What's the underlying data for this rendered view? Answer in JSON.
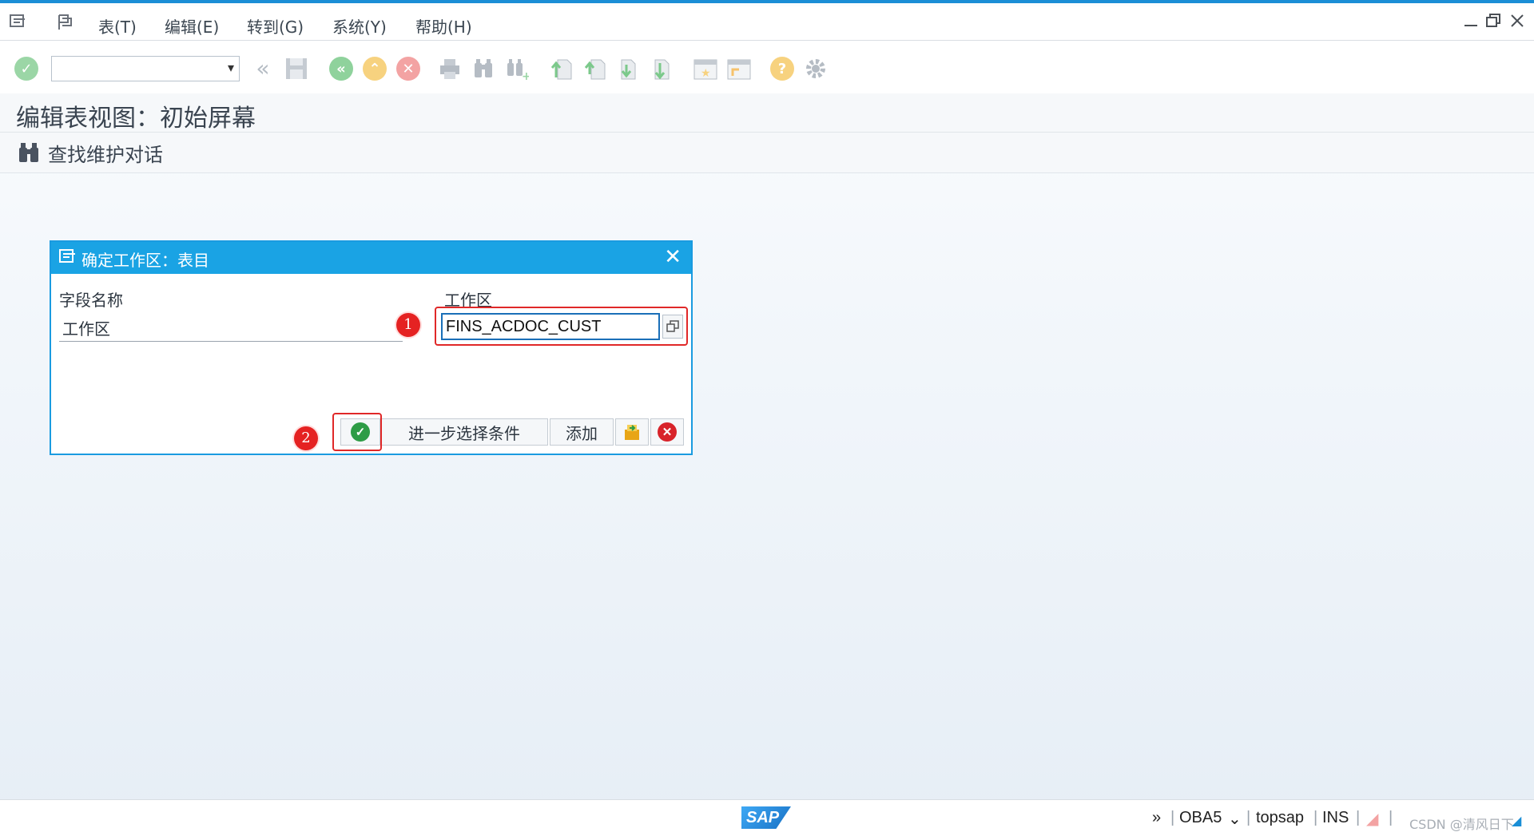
{
  "menu": {
    "items": [
      {
        "label": "表(T)"
      },
      {
        "label": "编辑(E)"
      },
      {
        "label": "转到(G)"
      },
      {
        "label": "系统(Y)"
      },
      {
        "label": "帮助(H)"
      }
    ]
  },
  "toolbar": {
    "command_field_value": "",
    "icons": [
      "enter-icon",
      "back-icon",
      "save-icon",
      "back-green-icon",
      "exit-icon",
      "cancel-icon",
      "print-icon",
      "find-icon",
      "find-next-icon",
      "first-page-icon",
      "previous-page-icon",
      "next-page-icon",
      "last-page-icon",
      "create-session-icon",
      "shortcut-icon",
      "help-icon",
      "settings-icon"
    ]
  },
  "page": {
    "title": "编辑表视图：初始屏幕",
    "app_button_label": "查找维护对话"
  },
  "dialog": {
    "title": "确定工作区：表目",
    "col_header_name": "字段名称",
    "col_header_value": "工作区",
    "field_label": "工作区",
    "field_value": "FINS_ACDOC_CUST",
    "btn_further_selection": "进一步选择条件",
    "btn_add": "添加",
    "callouts": [
      "1",
      "2"
    ]
  },
  "status": {
    "tcode": "OBA5",
    "server": "topsap",
    "mode": "INS",
    "watermark": "CSDN @清风日下"
  },
  "colors": {
    "accent": "#1aa3e4",
    "ok_green": "#2e9c46",
    "cancel_red": "#d8232a",
    "callout_red": "#e52222"
  }
}
